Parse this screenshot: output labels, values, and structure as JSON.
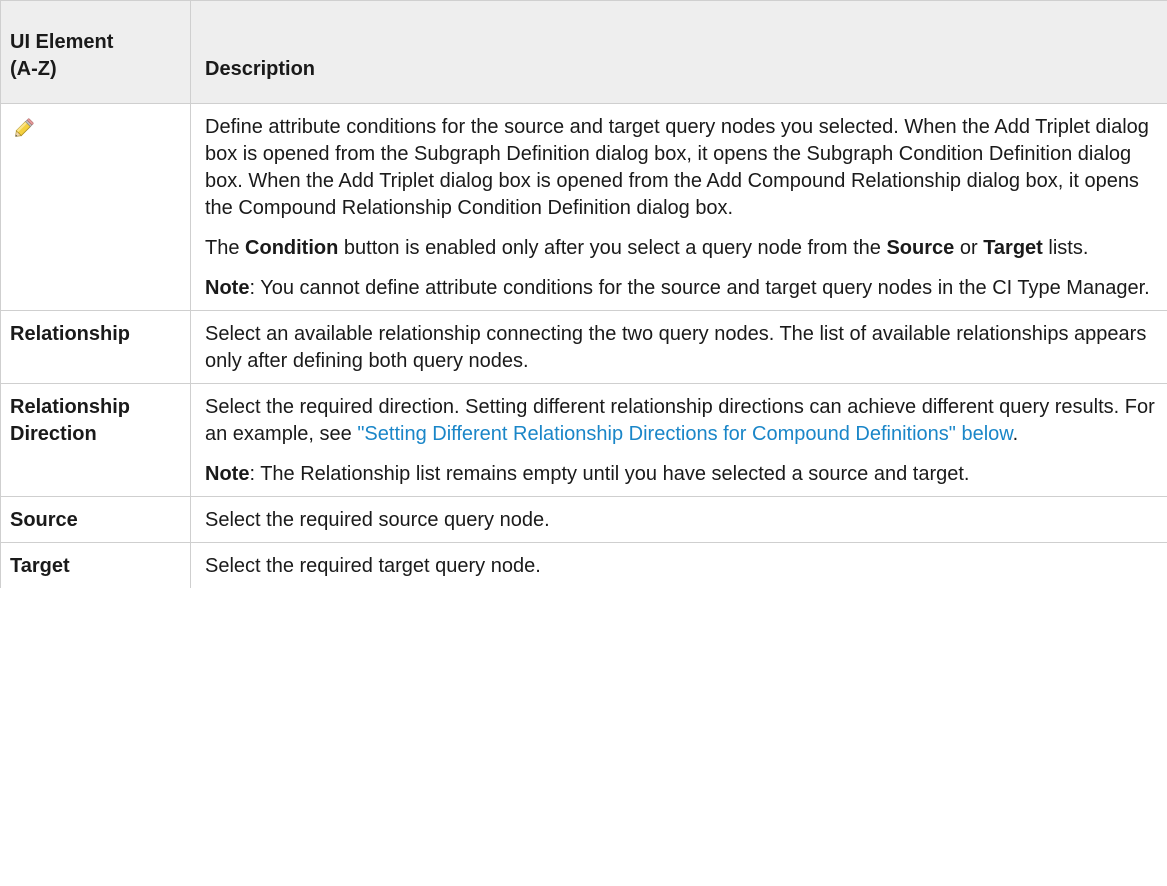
{
  "header": {
    "col1_line1": "UI Element",
    "col1_line2": "(A-Z)",
    "col2": "Description"
  },
  "rows": [
    {
      "element_icon": "pencil-icon",
      "paragraphs": [
        {
          "text": "Define attribute conditions for the source and target query nodes you selected. When the Add Triplet dialog box is opened from the Subgraph Definition dialog box, it opens the Subgraph Condition Definition dialog box. When the Add Triplet dialog box is opened from the Add Compound Relationship dialog box, it opens the Compound Relationship Condition Definition dialog box."
        },
        {
          "the": "The ",
          "condition": "Condition",
          "mid": " button is enabled only after you select a query node from the ",
          "source": "Source",
          "or": " or ",
          "target": "Target",
          "end": " lists."
        },
        {
          "note": "Note",
          "text": ": You cannot define attribute conditions for the source and target query nodes in the CI Type Manager."
        }
      ]
    },
    {
      "element": "Relationship",
      "paragraphs": [
        {
          "text": "Select an available relationship connecting the two query nodes. The list of available relationships appears only after defining both query nodes."
        }
      ]
    },
    {
      "element_line1": "Relationship",
      "element_line2": "Direction",
      "paragraphs": [
        {
          "text": "Select the required direction. Setting different relationship directions can achieve different query results. For an example, see ",
          "link": "\"Setting Different Relationship Directions for Compound Definitions\" below",
          "end": "."
        },
        {
          "note": "Note",
          "text": ": The Relationship list remains empty until you have selected a source and target."
        }
      ]
    },
    {
      "element": "Source",
      "paragraphs": [
        {
          "text": "Select the required source query node."
        }
      ]
    },
    {
      "element": "Target",
      "paragraphs": [
        {
          "text": "Select the required target query node."
        }
      ]
    }
  ],
  "colors": {
    "header_bg": "#eeeeee",
    "border": "#cfcfcf",
    "link": "#1a86c8",
    "text": "#1a1a1a"
  }
}
